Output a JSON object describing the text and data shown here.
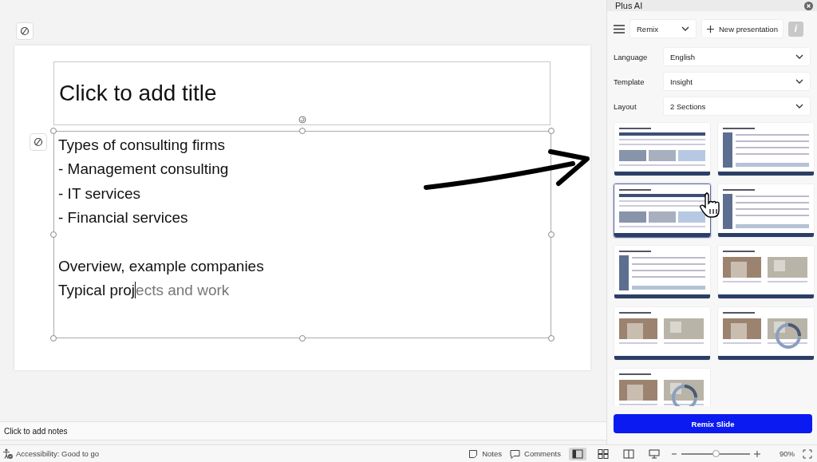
{
  "slide": {
    "title_placeholder": "Click to add title",
    "body_paragraphs": [
      [
        "Types of consulting firms",
        "- Management consulting",
        "- IT services",
        "- Financial services"
      ],
      [
        "Overview, example companies"
      ]
    ],
    "typing_line": {
      "typed": "Typical proj",
      "suggestion": "ects and work"
    }
  },
  "notes": {
    "placeholder": "Click to add notes"
  },
  "panel": {
    "title": "Plus AI",
    "mode": "Remix",
    "new_button": "New presentation",
    "info": "i",
    "fields": [
      {
        "label": "Language",
        "value": "English"
      },
      {
        "label": "Template",
        "value": "Insight"
      },
      {
        "label": "Layout",
        "value": "2 Sections"
      }
    ],
    "thumbnails": [
      {
        "kind": "table",
        "selected": false
      },
      {
        "kind": "grid",
        "selected": false
      },
      {
        "kind": "table",
        "selected": true
      },
      {
        "kind": "grid",
        "selected": false
      },
      {
        "kind": "grid",
        "selected": false
      },
      {
        "kind": "photos",
        "selected": false
      },
      {
        "kind": "photos",
        "selected": false
      },
      {
        "kind": "photos-chart",
        "selected": false
      },
      {
        "kind": "photos-chart",
        "selected": false
      }
    ],
    "action": "Remix Slide"
  },
  "status_bar": {
    "accessibility": "Accessibility: Good to go",
    "notes": "Notes",
    "comments": "Comments",
    "views": [
      {
        "kind": "normal",
        "selected": true
      },
      {
        "kind": "sorter",
        "selected": false
      },
      {
        "kind": "reading",
        "selected": false
      },
      {
        "kind": "show",
        "selected": false
      }
    ],
    "zoom": {
      "level": 0.5,
      "reading": "90%"
    }
  }
}
